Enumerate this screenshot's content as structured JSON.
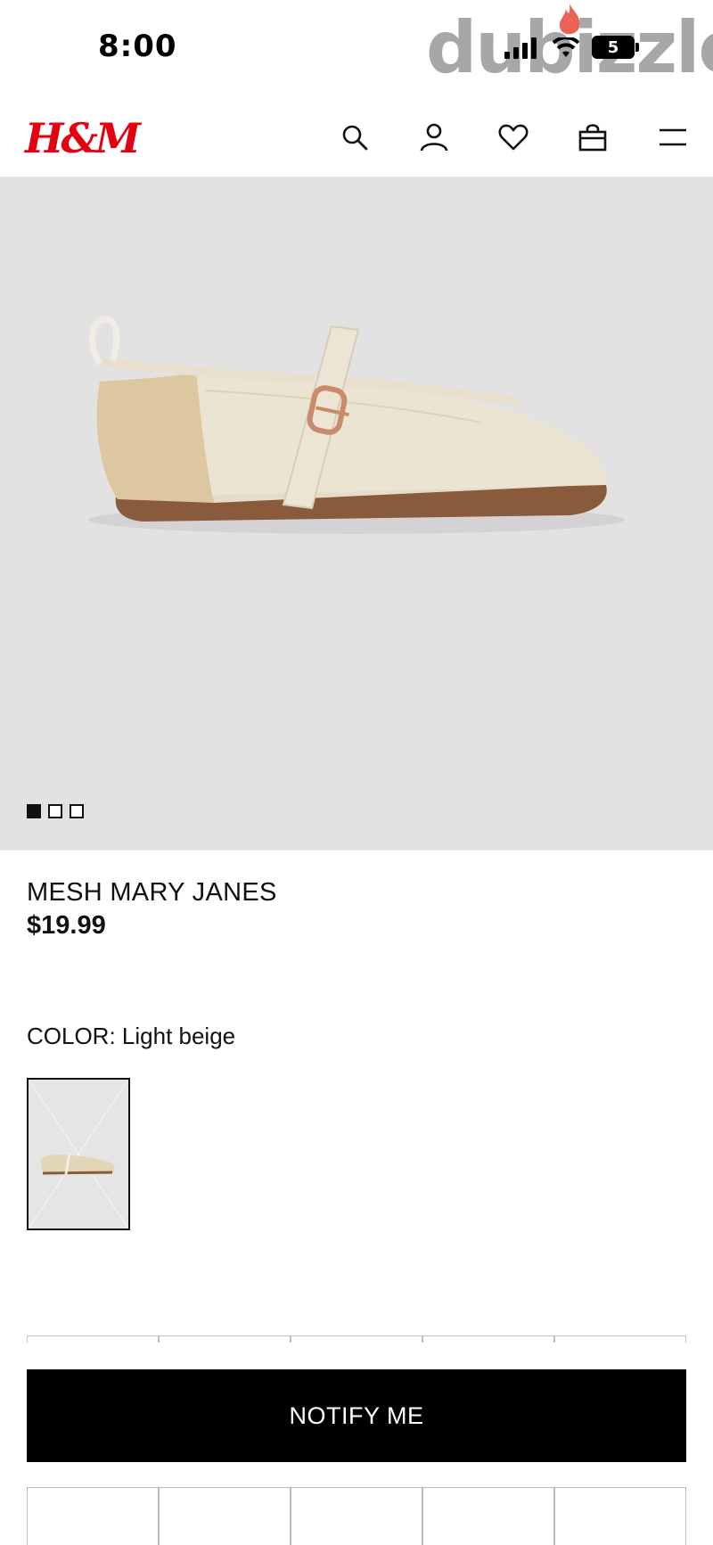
{
  "status_bar": {
    "time": "8:00",
    "battery": "5",
    "icons": [
      "signal-icon",
      "wifi-icon",
      "battery-icon"
    ]
  },
  "watermark": {
    "text": "dubizzle"
  },
  "header": {
    "logo": "H&M",
    "icons": [
      "search-icon",
      "account-icon",
      "favorites-icon",
      "bag-icon",
      "menu-icon"
    ]
  },
  "gallery": {
    "image_count": 3,
    "active_index": 0,
    "background_color": "#e3e2e3"
  },
  "product": {
    "title": "MESH MARY JANES",
    "price": "$19.99",
    "color_label": "COLOR: Light beige"
  },
  "actions": {
    "notify_label": "NOTIFY ME"
  },
  "colors": {
    "brand_red": "#e50010",
    "button_bg": "#000000",
    "button_text": "#ffffff"
  }
}
